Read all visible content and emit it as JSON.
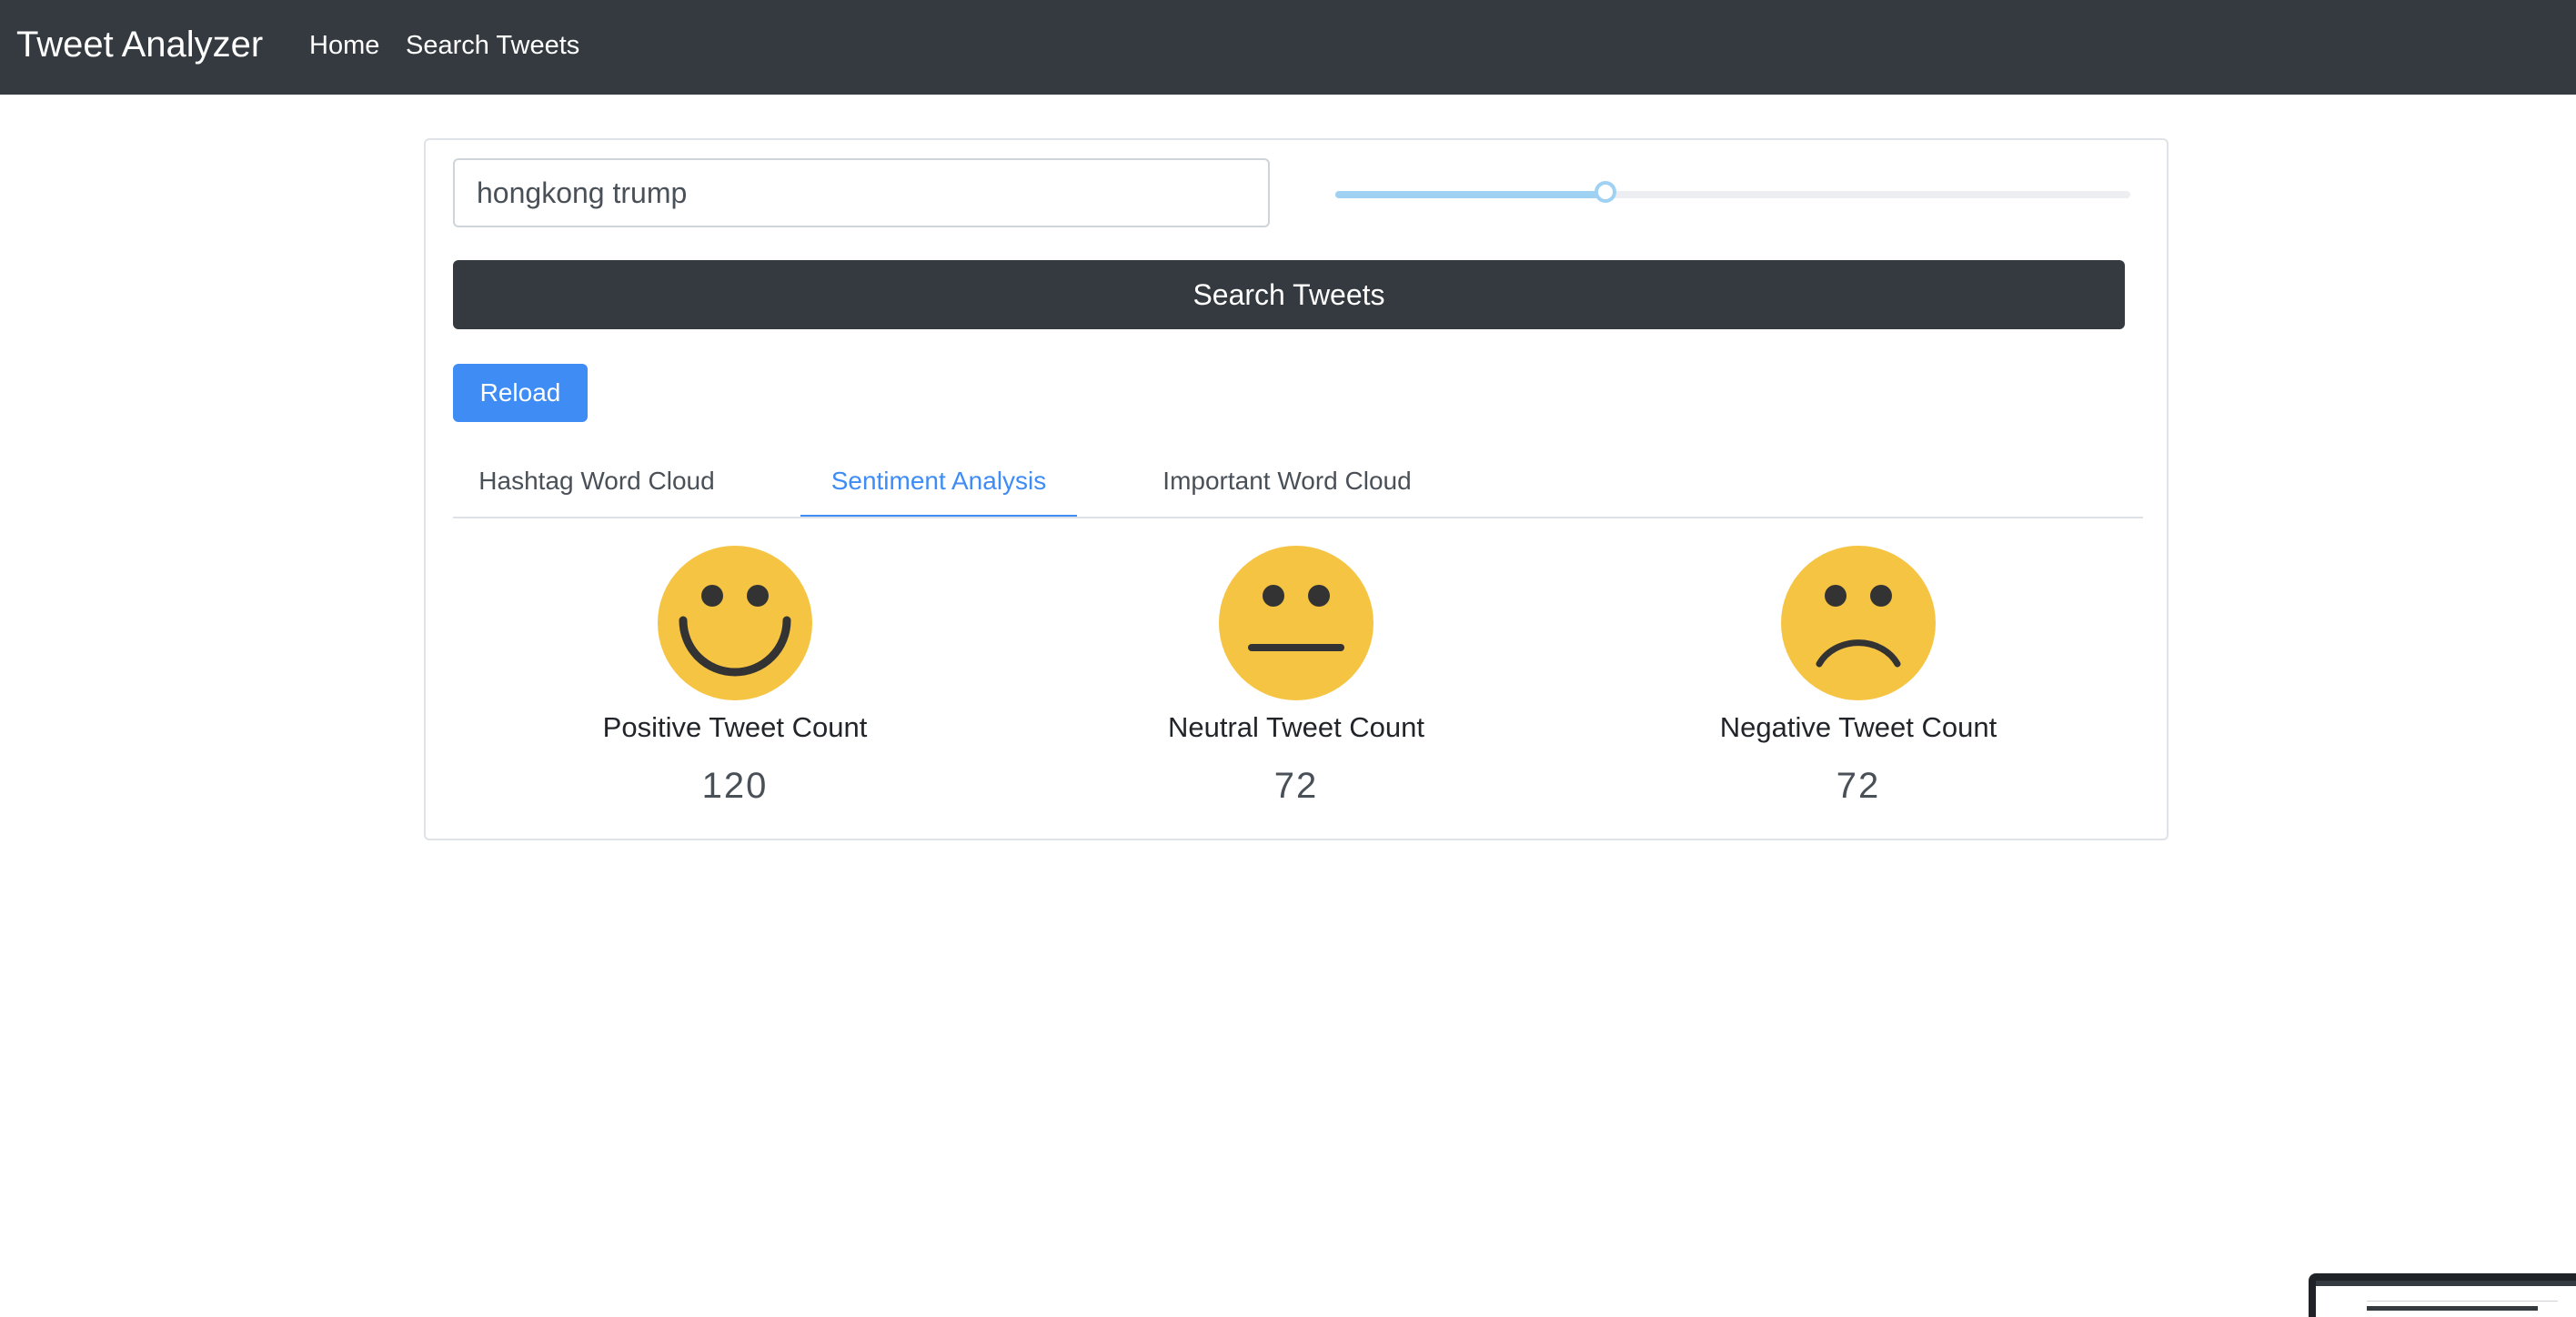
{
  "navbar": {
    "brand": "Tweet Analyzer",
    "links": [
      "Home",
      "Search Tweets"
    ]
  },
  "search": {
    "query": "hongkong trump",
    "button_label": "Search Tweets",
    "slider_value_fraction": 0.34
  },
  "reload_label": "Reload",
  "tabs": [
    {
      "label": "Hashtag Word Cloud",
      "active": false
    },
    {
      "label": "Sentiment Analysis",
      "active": true
    },
    {
      "label": "Important Word Cloud",
      "active": false
    }
  ],
  "sentiment": {
    "positive": {
      "label": "Positive Tweet Count",
      "count": "120",
      "icon": "smiling-face-icon"
    },
    "neutral": {
      "label": "Neutral Tweet Count",
      "count": "72",
      "icon": "neutral-face-icon"
    },
    "negative": {
      "label": "Negative Tweet Count",
      "count": "72",
      "icon": "frowning-face-icon"
    }
  },
  "colors": {
    "navbar": "#343a40",
    "accent": "#3e8cf4",
    "face": "#f6c443",
    "slider": "#9fd2f2"
  }
}
